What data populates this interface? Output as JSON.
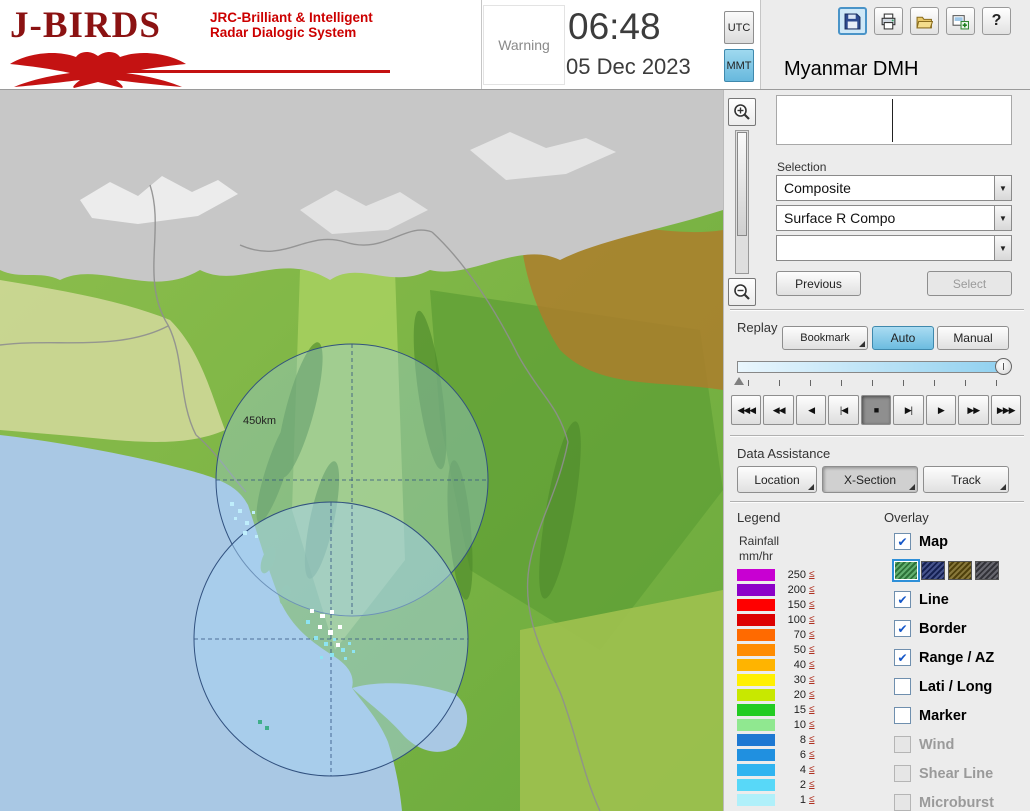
{
  "header": {
    "logo": {
      "title": "J-BIRDS",
      "subtitle_line1": "JRC-Brilliant & Intelligent",
      "subtitle_line2": "Radar  Dialogic  System"
    },
    "warning_label": "Warning",
    "clock": {
      "time": "06:48",
      "date": "05 Dec 2023"
    },
    "timezone": {
      "utc": "UTC",
      "mmt": "MMT",
      "selected": "MMT"
    },
    "toolbar": [
      {
        "name": "save",
        "icon": "floppy-icon",
        "selected": true
      },
      {
        "name": "print",
        "icon": "printer-icon",
        "selected": false
      },
      {
        "name": "open",
        "icon": "folder-icon",
        "selected": false
      },
      {
        "name": "export",
        "icon": "image-plus-icon",
        "selected": false
      },
      {
        "name": "help",
        "icon": "question-icon",
        "glyph": "?",
        "selected": false
      }
    ],
    "organization": "Myanmar DMH"
  },
  "selection": {
    "label": "Selection",
    "dropdowns": [
      {
        "value": "Composite"
      },
      {
        "value": "Surface R Compo"
      },
      {
        "value": ""
      }
    ],
    "previous_label": "Previous",
    "select_label": "Select",
    "select_disabled": true
  },
  "replay": {
    "label": "Replay",
    "bookmark_label": "Bookmark",
    "auto_label": "Auto",
    "manual_label": "Manual",
    "selected_mode": "Auto",
    "playback": [
      {
        "glyph": "◀◀◀",
        "name": "jump-to-start"
      },
      {
        "glyph": "◀◀",
        "name": "fast-rewind"
      },
      {
        "glyph": "◀",
        "name": "play-reverse"
      },
      {
        "glyph": "|◀",
        "name": "step-back"
      },
      {
        "glyph": "■",
        "name": "stop",
        "pressed": true
      },
      {
        "glyph": "▶|",
        "name": "step-forward"
      },
      {
        "glyph": "▶",
        "name": "play"
      },
      {
        "glyph": "▶▶",
        "name": "fast-forward"
      },
      {
        "glyph": "▶▶▶",
        "name": "jump-to-end"
      }
    ]
  },
  "data_assistance": {
    "label": "Data Assistance",
    "buttons": [
      "Location",
      "X-Section",
      "Track"
    ],
    "pressed": "X-Section"
  },
  "legend": {
    "title": "Legend",
    "subtitle1": "Rainfall",
    "subtitle2": "mm/hr",
    "le_symbol": "≤",
    "rows": [
      {
        "value": "250",
        "color": "#c800d2"
      },
      {
        "value": "200",
        "color": "#8c00c8"
      },
      {
        "value": "150",
        "color": "#ff0000"
      },
      {
        "value": "100",
        "color": "#dd0000"
      },
      {
        "value": "70",
        "color": "#ff6a00"
      },
      {
        "value": "50",
        "color": "#ff8c00"
      },
      {
        "value": "40",
        "color": "#ffb400"
      },
      {
        "value": "30",
        "color": "#fff000"
      },
      {
        "value": "20",
        "color": "#c8e800"
      },
      {
        "value": "15",
        "color": "#22cc22"
      },
      {
        "value": "10",
        "color": "#90e890"
      },
      {
        "value": "8",
        "color": "#1e78d2"
      },
      {
        "value": "6",
        "color": "#2090e0"
      },
      {
        "value": "4",
        "color": "#30b4f0"
      },
      {
        "value": "2",
        "color": "#58d8f8"
      },
      {
        "value": "1",
        "color": "#b0f0fa"
      }
    ]
  },
  "overlay": {
    "title": "Overlay",
    "items": [
      {
        "label": "Map",
        "checked": true,
        "disabled": false
      },
      {
        "label": "Line",
        "checked": true,
        "disabled": false
      },
      {
        "label": "Border",
        "checked": true,
        "disabled": false
      },
      {
        "label": "Range / AZ",
        "checked": true,
        "disabled": false
      },
      {
        "label": "Lati / Long",
        "checked": false,
        "disabled": false
      },
      {
        "label": "Marker",
        "checked": false,
        "disabled": false
      },
      {
        "label": "Wind",
        "checked": false,
        "disabled": true
      },
      {
        "label": "Shear Line",
        "checked": false,
        "disabled": true
      },
      {
        "label": "Microburst",
        "checked": false,
        "disabled": true
      }
    ],
    "map_swatches": {
      "colors": [
        "#3f9e4f",
        "#1d2d72",
        "#6e5a10",
        "#45454e"
      ],
      "selected_index": 0
    }
  },
  "map": {
    "range_label": "450km"
  },
  "colors": {
    "accent_selected": "#6cbce0",
    "panel_background": "#ececec",
    "sea": "#a9c8e4",
    "logo_red": "#c41212",
    "check_blue": "#1456c8"
  }
}
